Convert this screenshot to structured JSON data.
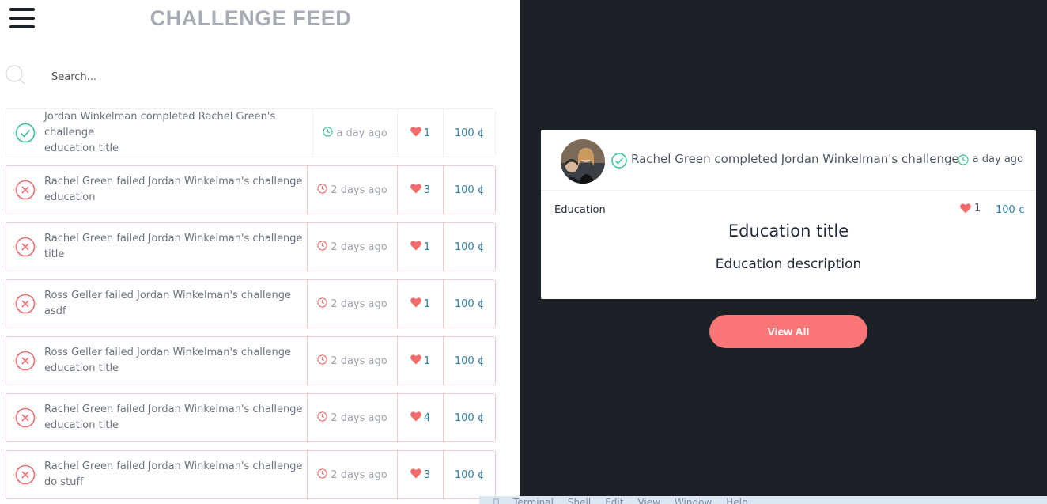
{
  "header": {
    "title": "CHALLENGE FEED"
  },
  "search": {
    "placeholder": "Search..."
  },
  "feed": [
    {
      "status": "completed",
      "line1": "Jordan Winkelman completed Rachel Green's challenge",
      "line2": "education title",
      "time": "a day ago",
      "likes": "1",
      "coins": "100 ¢"
    },
    {
      "status": "failed",
      "line1": "Rachel Green failed Jordan Winkelman's challenge",
      "line2": "education",
      "time": "2 days ago",
      "likes": "3",
      "coins": "100 ¢"
    },
    {
      "status": "failed",
      "line1": "Rachel Green failed Jordan Winkelman's challenge",
      "line2": "title",
      "time": "2 days ago",
      "likes": "1",
      "coins": "100 ¢"
    },
    {
      "status": "failed",
      "line1": "Ross Geller failed Jordan Winkelman's challenge",
      "line2": "asdf",
      "time": "2 days ago",
      "likes": "1",
      "coins": "100 ¢"
    },
    {
      "status": "failed",
      "line1": "Ross Geller failed Jordan Winkelman's challenge",
      "line2": "education title",
      "time": "2 days ago",
      "likes": "1",
      "coins": "100 ¢"
    },
    {
      "status": "failed",
      "line1": "Rachel Green failed Jordan Winkelman's challenge",
      "line2": "education title",
      "time": "2 days ago",
      "likes": "4",
      "coins": "100 ¢"
    },
    {
      "status": "failed",
      "line1": "Rachel Green failed Jordan Winkelman's challenge",
      "line2": "do stuff",
      "time": "2 days ago",
      "likes": "3",
      "coins": "100 ¢"
    }
  ],
  "detail": {
    "action": "Rachel Green completed Jordan Winkelman's challenge",
    "time": "a day ago",
    "category": "Education",
    "likes": "1",
    "coins": "100 ¢",
    "title": "Education title",
    "description": "Education description",
    "button": "View All"
  },
  "os_menu": [
    "Terminal",
    "Shell",
    "Edit",
    "View",
    "Window",
    "Help"
  ],
  "colors": {
    "accent": "#fb7676",
    "success": "#34c38f",
    "failure": "#f06a6a",
    "link": "#2f7ea8",
    "dark_bg": "#1c2127"
  }
}
